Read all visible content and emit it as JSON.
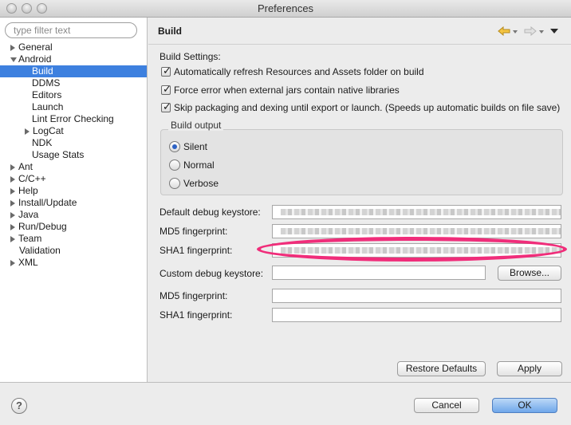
{
  "window": {
    "title": "Preferences"
  },
  "sidebar": {
    "filter_placeholder": "type filter text",
    "items": [
      {
        "label": "General",
        "arrow": "right",
        "indent": 0
      },
      {
        "label": "Android",
        "arrow": "down",
        "indent": 0
      },
      {
        "label": "Build",
        "arrow": "",
        "indent": 2,
        "selected": true
      },
      {
        "label": "DDMS",
        "arrow": "",
        "indent": 2
      },
      {
        "label": "Editors",
        "arrow": "",
        "indent": 2
      },
      {
        "label": "Launch",
        "arrow": "",
        "indent": 2
      },
      {
        "label": "Lint Error Checking",
        "arrow": "",
        "indent": 2
      },
      {
        "label": "LogCat",
        "arrow": "right",
        "indent": 1
      },
      {
        "label": "NDK",
        "arrow": "",
        "indent": 2
      },
      {
        "label": "Usage Stats",
        "arrow": "",
        "indent": 2
      },
      {
        "label": "Ant",
        "arrow": "right",
        "indent": 0
      },
      {
        "label": "C/C++",
        "arrow": "right",
        "indent": 0
      },
      {
        "label": "Help",
        "arrow": "right",
        "indent": 0
      },
      {
        "label": "Install/Update",
        "arrow": "right",
        "indent": 0
      },
      {
        "label": "Java",
        "arrow": "right",
        "indent": 0
      },
      {
        "label": "Run/Debug",
        "arrow": "right",
        "indent": 0
      },
      {
        "label": "Team",
        "arrow": "right",
        "indent": 0
      },
      {
        "label": "Validation",
        "arrow": "",
        "indent": 0
      },
      {
        "label": "XML",
        "arrow": "right",
        "indent": 0
      }
    ]
  },
  "page": {
    "title": "Build",
    "section_label": "Build Settings:",
    "checkboxes": [
      {
        "label": "Automatically refresh Resources and Assets folder on build",
        "checked": true
      },
      {
        "label": "Force error when external jars contain native libraries",
        "checked": true
      },
      {
        "label": "Skip packaging and dexing until export or launch. (Speeds up automatic builds on file save)",
        "checked": true
      }
    ],
    "build_output": {
      "label": "Build output",
      "options": [
        {
          "label": "Silent",
          "selected": true
        },
        {
          "label": "Normal",
          "selected": false
        },
        {
          "label": "Verbose",
          "selected": false
        }
      ]
    },
    "fields": {
      "default_keystore_label": "Default debug keystore:",
      "md5_label": "MD5 fingerprint:",
      "sha1_label": "SHA1 fingerprint:",
      "custom_keystore_label": "Custom debug keystore:",
      "custom_md5_label": "MD5 fingerprint:",
      "custom_sha1_label": "SHA1 fingerprint:"
    },
    "browse_label": "Browse...",
    "restore_defaults_label": "Restore Defaults",
    "apply_label": "Apply",
    "highlight_color": "#f02d7a"
  },
  "footer": {
    "help_symbol": "?",
    "cancel_label": "Cancel",
    "ok_label": "OK"
  }
}
